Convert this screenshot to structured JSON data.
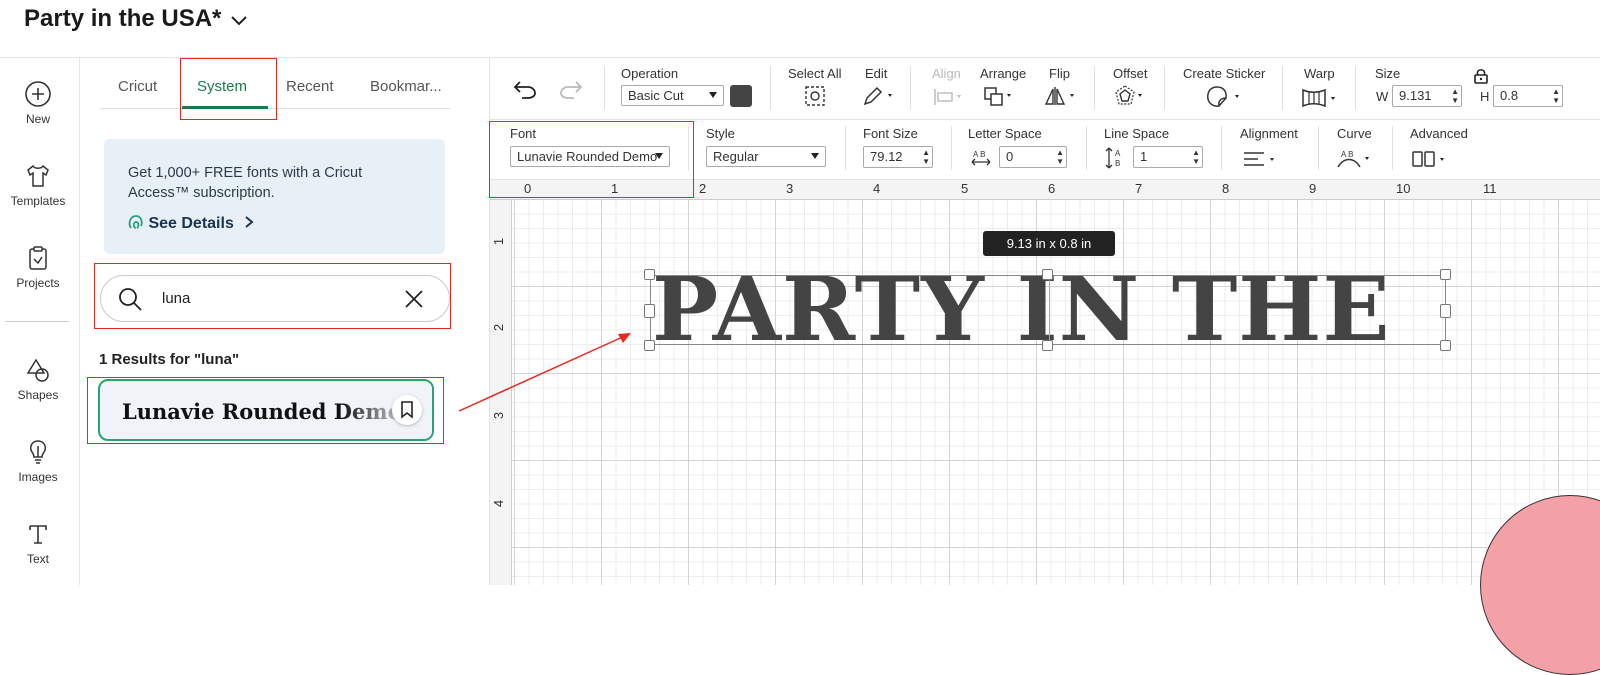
{
  "header": {
    "title": "Party in the USA*"
  },
  "leftnav": [
    {
      "label": "New",
      "icon": "plus-circle-icon"
    },
    {
      "label": "Templates",
      "icon": "shirt-icon"
    },
    {
      "label": "Projects",
      "icon": "projects-icon"
    },
    {
      "label": "Shapes",
      "icon": "shapes-icon"
    },
    {
      "label": "Images",
      "icon": "lightbulb-icon"
    },
    {
      "label": "Text",
      "icon": "text-icon"
    }
  ],
  "font_panel": {
    "tabs": [
      "Cricut",
      "System",
      "Recent",
      "Bookmar..."
    ],
    "active_tab": "System",
    "promo": {
      "text": "Get 1,000+ FREE fonts with a Cricut Access™ subscription.",
      "link": "See Details"
    },
    "search": {
      "value": "luna"
    },
    "results_label": "1 Results for \"luna\"",
    "results": [
      {
        "name": "Lunavie Rounded Demo"
      }
    ]
  },
  "toolbar": {
    "operation": {
      "label": "Operation",
      "value": "Basic Cut"
    },
    "select_all": "Select All",
    "edit": "Edit",
    "align": "Align",
    "arrange": "Arrange",
    "flip": "Flip",
    "offset": "Offset",
    "create_sticker": "Create Sticker",
    "warp": "Warp",
    "size": {
      "label": "Size",
      "w_label": "W",
      "w": "9.131",
      "h_label": "H",
      "h": "0.8"
    }
  },
  "text_toolbar": {
    "font": {
      "label": "Font",
      "value": "Lunavie Rounded Demo"
    },
    "style": {
      "label": "Style",
      "value": "Regular"
    },
    "font_size": {
      "label": "Font Size",
      "value": "79.12"
    },
    "letter_space": {
      "label": "Letter Space",
      "value": "0"
    },
    "line_space": {
      "label": "Line Space",
      "value": "1"
    },
    "alignment": "Alignment",
    "curve": "Curve",
    "advanced": "Advanced"
  },
  "ruler": {
    "top": [
      "0",
      "1",
      "2",
      "3",
      "4",
      "5",
      "6",
      "7",
      "8",
      "9",
      "10",
      "11"
    ],
    "left": [
      "1",
      "2",
      "3",
      "4"
    ]
  },
  "canvas": {
    "tooltip": "9.13  in x 0.8  in",
    "text": "PARTY IN THE"
  },
  "colors": {
    "accent": "#1b7a4b",
    "highlight": "#e8281e",
    "swatch": "#444444"
  }
}
